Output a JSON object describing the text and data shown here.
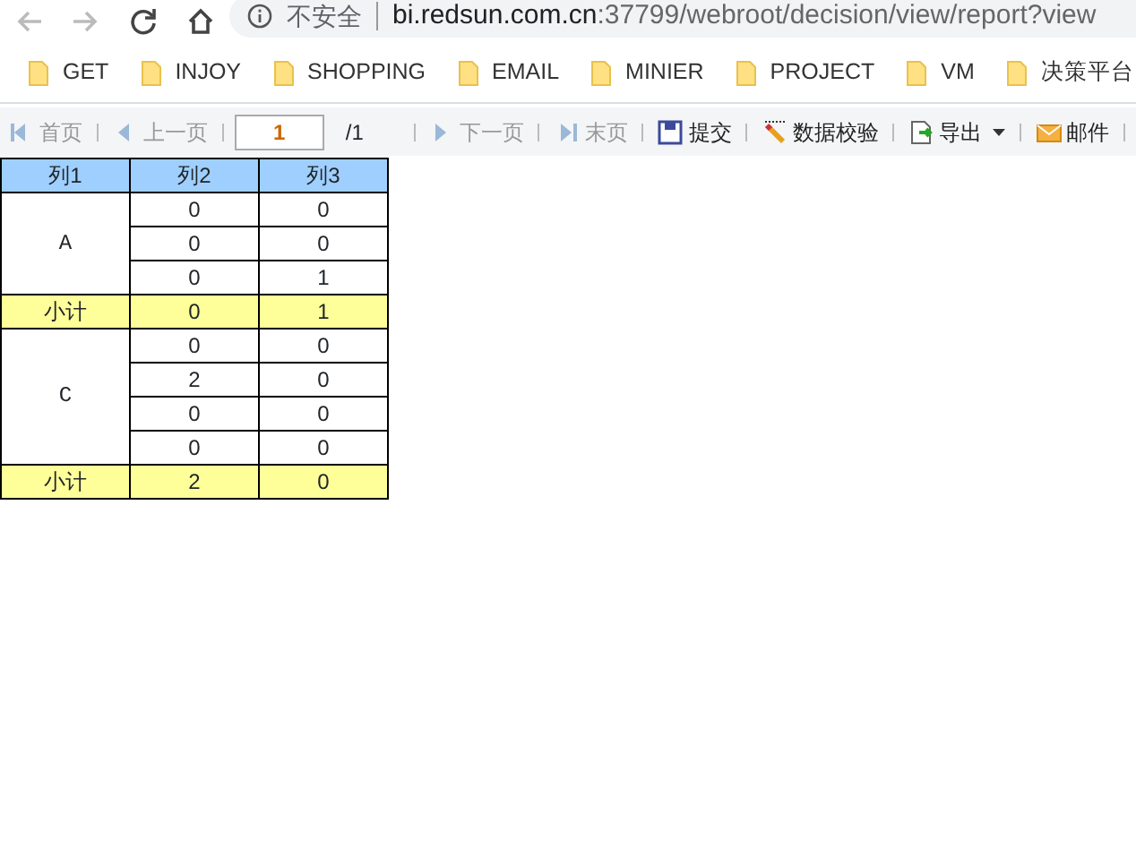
{
  "browser": {
    "nav_buttons": [
      {
        "kind": "back",
        "disabled": true
      },
      {
        "kind": "forward",
        "disabled": true
      },
      {
        "kind": "reload",
        "disabled": false
      },
      {
        "kind": "home",
        "disabled": false
      }
    ],
    "security_label": "不安全",
    "url_host": "bi.redsun.com.cn",
    "url_rest": ":37799/webroot/decision/view/report?view"
  },
  "bookmarks": [
    "GET",
    "INJOY",
    "SHOPPING",
    "EMAIL",
    "MINIER",
    "PROJECT",
    "VM",
    "决策平台"
  ],
  "toolbar": [
    {
      "kind": "first",
      "label": "首页",
      "disabled": true
    },
    {
      "kind": "prev",
      "label": "上一页",
      "disabled": true
    },
    {
      "kind": "page",
      "value": "1",
      "total": "/1"
    },
    {
      "kind": "next",
      "label": "下一页",
      "disabled": true
    },
    {
      "kind": "last",
      "label": "末页",
      "disabled": true
    },
    {
      "kind": "submit",
      "label": "提交",
      "disabled": false
    },
    {
      "kind": "validate",
      "label": "数据校验",
      "disabled": false
    },
    {
      "kind": "export",
      "label": "导出",
      "disabled": false
    },
    {
      "kind": "mail",
      "label": "邮件",
      "disabled": false
    }
  ],
  "table": {
    "columns": [
      "列1",
      "列2",
      "列3"
    ],
    "groups": [
      {
        "label": "A",
        "rows": [
          [
            "0",
            "0"
          ],
          [
            "0",
            "0"
          ],
          [
            "0",
            "1"
          ]
        ],
        "subtotal": [
          "小计",
          "0",
          "1"
        ]
      },
      {
        "label": "C",
        "rows": [
          [
            "0",
            "0"
          ],
          [
            "2",
            "0"
          ],
          [
            "0",
            "0"
          ],
          [
            "0",
            "0"
          ]
        ],
        "subtotal": [
          "小计",
          "2",
          "0"
        ]
      }
    ]
  }
}
